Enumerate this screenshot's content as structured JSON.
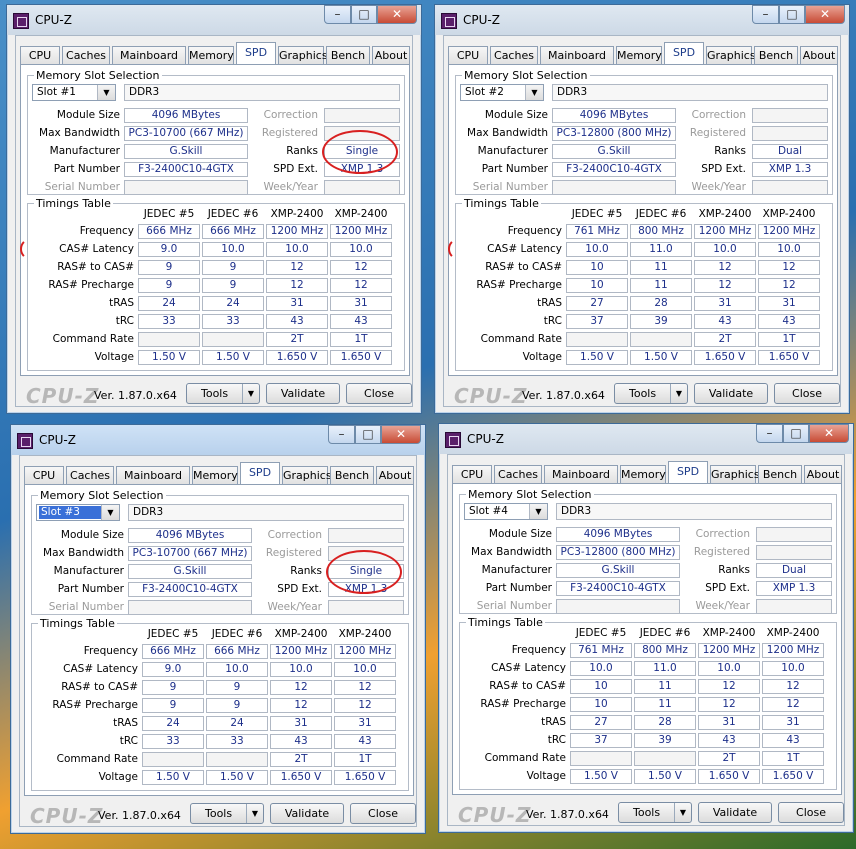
{
  "windows": [
    {
      "title": "CPU-Z",
      "active": false,
      "tabs": [
        "CPU",
        "Caches",
        "Mainboard",
        "Memory",
        "SPD",
        "Graphics",
        "Bench",
        "About"
      ],
      "active_tab": "SPD",
      "group_slot_title": "Memory Slot Selection",
      "slot": "Slot #1",
      "slot_selected": false,
      "memory_type": "DDR3",
      "labels": {
        "module_size": "Module Size",
        "max_bandwidth": "Max Bandwidth",
        "manufacturer": "Manufacturer",
        "part_number": "Part Number",
        "serial_number": "Serial Number",
        "correction": "Correction",
        "registered": "Registered",
        "ranks": "Ranks",
        "spd_ext": "SPD Ext.",
        "week_year": "Week/Year"
      },
      "module_size": "4096 MBytes",
      "max_bandwidth": "PC3-10700 (667 MHz)",
      "manufacturer": "G.Skill",
      "part_number": "F3-2400C10-4GTX",
      "ranks": "Single",
      "spd_ext": "XMP 1.3",
      "timings_title": "Timings Table",
      "timings_columns": [
        "JEDEC #5",
        "JEDEC #6",
        "XMP-2400",
        "XMP-2400"
      ],
      "timings_rows": [
        {
          "label": "Frequency",
          "values": [
            "666 MHz",
            "666 MHz",
            "1200 MHz",
            "1200 MHz"
          ]
        },
        {
          "label": "CAS# Latency",
          "values": [
            "9.0",
            "10.0",
            "10.0",
            "10.0"
          ]
        },
        {
          "label": "RAS# to CAS#",
          "values": [
            "9",
            "9",
            "12",
            "12"
          ]
        },
        {
          "label": "RAS# Precharge",
          "values": [
            "9",
            "9",
            "12",
            "12"
          ]
        },
        {
          "label": "tRAS",
          "values": [
            "24",
            "24",
            "31",
            "31"
          ]
        },
        {
          "label": "tRC",
          "values": [
            "33",
            "33",
            "43",
            "43"
          ]
        },
        {
          "label": "Command Rate",
          "values": [
            "",
            "",
            "2T",
            "1T"
          ]
        },
        {
          "label": "Voltage",
          "values": [
            "1.50 V",
            "1.50 V",
            "1.650 V",
            "1.650 V"
          ]
        }
      ],
      "footer": {
        "logo": "CPU-Z",
        "version": "Ver. 1.87.0.x64",
        "tools": "Tools",
        "validate": "Validate",
        "close": "Close"
      },
      "annotations": {
        "ranks_circle": true,
        "cas_arc": true
      }
    },
    {
      "title": "CPU-Z",
      "active": false,
      "tabs": [
        "CPU",
        "Caches",
        "Mainboard",
        "Memory",
        "SPD",
        "Graphics",
        "Bench",
        "About"
      ],
      "active_tab": "SPD",
      "group_slot_title": "Memory Slot Selection",
      "slot": "Slot #2",
      "slot_selected": false,
      "memory_type": "DDR3",
      "labels": {
        "module_size": "Module Size",
        "max_bandwidth": "Max Bandwidth",
        "manufacturer": "Manufacturer",
        "part_number": "Part Number",
        "serial_number": "Serial Number",
        "correction": "Correction",
        "registered": "Registered",
        "ranks": "Ranks",
        "spd_ext": "SPD Ext.",
        "week_year": "Week/Year"
      },
      "module_size": "4096 MBytes",
      "max_bandwidth": "PC3-12800 (800 MHz)",
      "manufacturer": "G.Skill",
      "part_number": "F3-2400C10-4GTX",
      "ranks": "Dual",
      "spd_ext": "XMP 1.3",
      "timings_title": "Timings Table",
      "timings_columns": [
        "JEDEC #5",
        "JEDEC #6",
        "XMP-2400",
        "XMP-2400"
      ],
      "timings_rows": [
        {
          "label": "Frequency",
          "values": [
            "761 MHz",
            "800 MHz",
            "1200 MHz",
            "1200 MHz"
          ]
        },
        {
          "label": "CAS# Latency",
          "values": [
            "10.0",
            "11.0",
            "10.0",
            "10.0"
          ]
        },
        {
          "label": "RAS# to CAS#",
          "values": [
            "10",
            "11",
            "12",
            "12"
          ]
        },
        {
          "label": "RAS# Precharge",
          "values": [
            "10",
            "11",
            "12",
            "12"
          ]
        },
        {
          "label": "tRAS",
          "values": [
            "27",
            "28",
            "31",
            "31"
          ]
        },
        {
          "label": "tRC",
          "values": [
            "37",
            "39",
            "43",
            "43"
          ]
        },
        {
          "label": "Command Rate",
          "values": [
            "",
            "",
            "2T",
            "1T"
          ]
        },
        {
          "label": "Voltage",
          "values": [
            "1.50 V",
            "1.50 V",
            "1.650 V",
            "1.650 V"
          ]
        }
      ],
      "footer": {
        "logo": "CPU-Z",
        "version": "Ver. 1.87.0.x64",
        "tools": "Tools",
        "validate": "Validate",
        "close": "Close"
      },
      "annotations": {
        "ranks_circle": false,
        "cas_arc": true
      }
    },
    {
      "title": "CPU-Z",
      "active": true,
      "tabs": [
        "CPU",
        "Caches",
        "Mainboard",
        "Memory",
        "SPD",
        "Graphics",
        "Bench",
        "About"
      ],
      "active_tab": "SPD",
      "group_slot_title": "Memory Slot Selection",
      "slot": "Slot #3",
      "slot_selected": true,
      "memory_type": "DDR3",
      "labels": {
        "module_size": "Module Size",
        "max_bandwidth": "Max Bandwidth",
        "manufacturer": "Manufacturer",
        "part_number": "Part Number",
        "serial_number": "Serial Number",
        "correction": "Correction",
        "registered": "Registered",
        "ranks": "Ranks",
        "spd_ext": "SPD Ext.",
        "week_year": "Week/Year"
      },
      "module_size": "4096 MBytes",
      "max_bandwidth": "PC3-10700 (667 MHz)",
      "manufacturer": "G.Skill",
      "part_number": "F3-2400C10-4GTX",
      "ranks": "Single",
      "spd_ext": "XMP 1.3",
      "timings_title": "Timings Table",
      "timings_columns": [
        "JEDEC #5",
        "JEDEC #6",
        "XMP-2400",
        "XMP-2400"
      ],
      "timings_rows": [
        {
          "label": "Frequency",
          "values": [
            "666 MHz",
            "666 MHz",
            "1200 MHz",
            "1200 MHz"
          ]
        },
        {
          "label": "CAS# Latency",
          "values": [
            "9.0",
            "10.0",
            "10.0",
            "10.0"
          ]
        },
        {
          "label": "RAS# to CAS#",
          "values": [
            "9",
            "9",
            "12",
            "12"
          ]
        },
        {
          "label": "RAS# Precharge",
          "values": [
            "9",
            "9",
            "12",
            "12"
          ]
        },
        {
          "label": "tRAS",
          "values": [
            "24",
            "24",
            "31",
            "31"
          ]
        },
        {
          "label": "tRC",
          "values": [
            "33",
            "33",
            "43",
            "43"
          ]
        },
        {
          "label": "Command Rate",
          "values": [
            "",
            "",
            "2T",
            "1T"
          ]
        },
        {
          "label": "Voltage",
          "values": [
            "1.50 V",
            "1.50 V",
            "1.650 V",
            "1.650 V"
          ]
        }
      ],
      "footer": {
        "logo": "CPU-Z",
        "version": "Ver. 1.87.0.x64",
        "tools": "Tools",
        "validate": "Validate",
        "close": "Close"
      },
      "annotations": {
        "ranks_circle": true,
        "cas_arc": false
      }
    },
    {
      "title": "CPU-Z",
      "active": false,
      "tabs": [
        "CPU",
        "Caches",
        "Mainboard",
        "Memory",
        "SPD",
        "Graphics",
        "Bench",
        "About"
      ],
      "active_tab": "SPD",
      "group_slot_title": "Memory Slot Selection",
      "slot": "Slot #4",
      "slot_selected": false,
      "memory_type": "DDR3",
      "labels": {
        "module_size": "Module Size",
        "max_bandwidth": "Max Bandwidth",
        "manufacturer": "Manufacturer",
        "part_number": "Part Number",
        "serial_number": "Serial Number",
        "correction": "Correction",
        "registered": "Registered",
        "ranks": "Ranks",
        "spd_ext": "SPD Ext.",
        "week_year": "Week/Year"
      },
      "module_size": "4096 MBytes",
      "max_bandwidth": "PC3-12800 (800 MHz)",
      "manufacturer": "G.Skill",
      "part_number": "F3-2400C10-4GTX",
      "ranks": "Dual",
      "spd_ext": "XMP 1.3",
      "timings_title": "Timings Table",
      "timings_columns": [
        "JEDEC #5",
        "JEDEC #6",
        "XMP-2400",
        "XMP-2400"
      ],
      "timings_rows": [
        {
          "label": "Frequency",
          "values": [
            "761 MHz",
            "800 MHz",
            "1200 MHz",
            "1200 MHz"
          ]
        },
        {
          "label": "CAS# Latency",
          "values": [
            "10.0",
            "11.0",
            "10.0",
            "10.0"
          ]
        },
        {
          "label": "RAS# to CAS#",
          "values": [
            "10",
            "11",
            "12",
            "12"
          ]
        },
        {
          "label": "RAS# Precharge",
          "values": [
            "10",
            "11",
            "12",
            "12"
          ]
        },
        {
          "label": "tRAS",
          "values": [
            "27",
            "28",
            "31",
            "31"
          ]
        },
        {
          "label": "tRC",
          "values": [
            "37",
            "39",
            "43",
            "43"
          ]
        },
        {
          "label": "Command Rate",
          "values": [
            "",
            "",
            "2T",
            "1T"
          ]
        },
        {
          "label": "Voltage",
          "values": [
            "1.50 V",
            "1.50 V",
            "1.650 V",
            "1.650 V"
          ]
        }
      ],
      "footer": {
        "logo": "CPU-Z",
        "version": "Ver. 1.87.0.x64",
        "tools": "Tools",
        "validate": "Validate",
        "close": "Close"
      },
      "annotations": {
        "ranks_circle": false,
        "cas_arc": false
      }
    }
  ]
}
